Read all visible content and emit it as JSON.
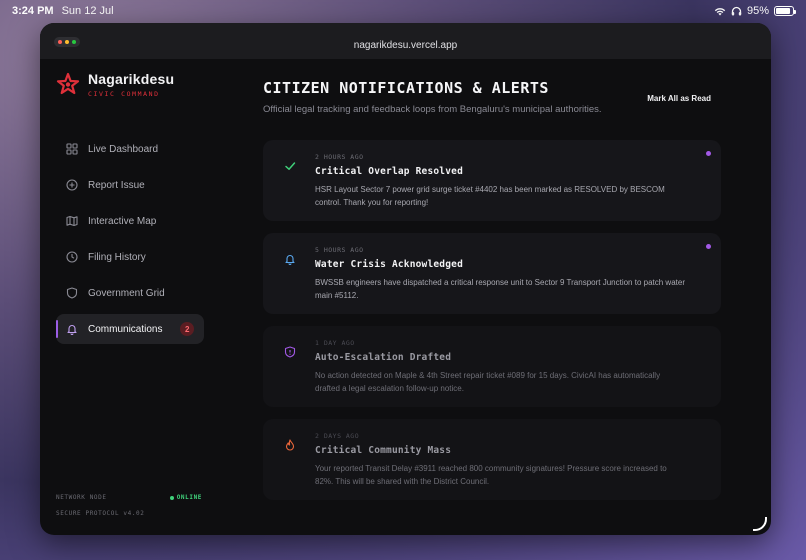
{
  "status_bar": {
    "time": "3:24 PM",
    "date": "Sun 12 Jul",
    "battery": "95%"
  },
  "browser": {
    "url": "nagarikdesu.vercel.app"
  },
  "brand": {
    "name": "Nagarikdesu",
    "tagline": "CIVIC COMMAND",
    "accent": "#e0303a"
  },
  "sidebar": {
    "items": [
      {
        "label": "Live Dashboard",
        "icon": "grid-icon"
      },
      {
        "label": "Report Issue",
        "icon": "plus-circle-icon"
      },
      {
        "label": "Interactive Map",
        "icon": "map-icon"
      },
      {
        "label": "Filing History",
        "icon": "clock-icon"
      },
      {
        "label": "Government Grid",
        "icon": "shield-icon"
      },
      {
        "label": "Communications",
        "icon": "bell-icon",
        "badge": "2",
        "active": true
      }
    ],
    "network_label": "NETWORK NODE",
    "network_status": "ONLINE",
    "protocol": "SECURE PROTOCOL v4.02"
  },
  "main": {
    "title": "CITIZEN NOTIFICATIONS & ALERTS",
    "subtitle": "Official legal tracking and feedback loops from Bengaluru's municipal authorities.",
    "mark_all_label": "Mark All as Read",
    "notifications": [
      {
        "time": "2 HOURS AGO",
        "title": "Critical Overlap Resolved",
        "body": "HSR Layout Sector 7 power grid surge ticket #4402 has been marked as RESOLVED by BESCOM control. Thank you for reporting!",
        "icon": "check-icon",
        "icon_color": "#3fd07a",
        "unread": true
      },
      {
        "time": "5 HOURS AGO",
        "title": "Water Crisis Acknowledged",
        "body": "BWSSB engineers have dispatched a critical response unit to Sector 9 Transport Junction to patch water main #5112.",
        "icon": "bell-icon",
        "icon_color": "#5aa9f0",
        "unread": true
      },
      {
        "time": "1 DAY AGO",
        "title": "Auto-Escalation Drafted",
        "body": "No action detected on Maple & 4th Street repair ticket #089 for 15 days. CivicAI has automatically drafted a legal escalation follow-up notice.",
        "icon": "shield-icon",
        "icon_color": "#a259e6",
        "unread": false
      },
      {
        "time": "2 DAYS AGO",
        "title": "Critical Community Mass",
        "body": "Your reported Transit Delay #3911 reached 800 community signatures! Pressure score increased to 82%. This will be shared with the District Council.",
        "icon": "flame-icon",
        "icon_color": "#e8663a",
        "unread": false
      }
    ]
  }
}
